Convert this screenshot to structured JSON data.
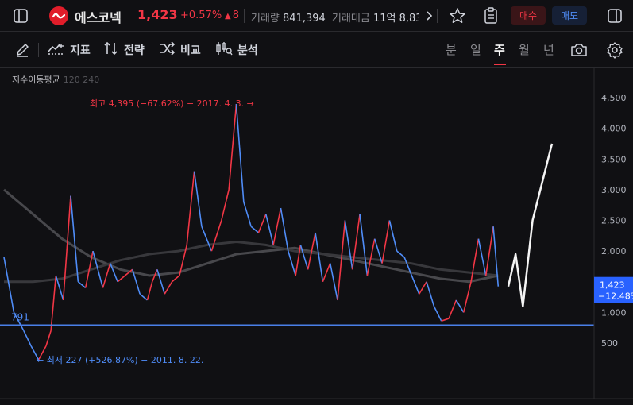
{
  "header": {
    "stock_name": "에스코넥",
    "price": "1,423",
    "change_pct": "+0.57%",
    "change_abs": "8",
    "change_arrow": "▲",
    "volume_label": "거래량",
    "volume_value": "841,394",
    "amount_label": "거래대금",
    "amount_value": "11억 8,83",
    "buy_label": "매수",
    "sell_label": "매도"
  },
  "toolbar": {
    "indicators_label": "지표",
    "strategy_label": "전략",
    "compare_label": "비교",
    "analysis_label": "분석",
    "periods": [
      "분",
      "일",
      "주",
      "월",
      "년"
    ],
    "active_period": "주"
  },
  "legend": {
    "title": "지수이동평균",
    "params": "120 240"
  },
  "colors": {
    "up": "#f23645",
    "down": "#4f8cf7",
    "hline": "#4a7fe8",
    "brand_logo": "#e11d2a",
    "ma_long": "#48484c",
    "ma_short": "#38383c",
    "projection": "#f5f5f5",
    "price_tag_bg": "#2962ff"
  },
  "chart_data": {
    "type": "line",
    "description_series": "weekly price series rendered as up/down colored segments",
    "yaxis": {
      "ticks": [
        "500",
        "1,000",
        "1,500",
        "2,000",
        "2,500",
        "3,000",
        "3,500",
        "4,000",
        "4,500"
      ],
      "ylim": [
        0,
        4900
      ]
    },
    "price_series": {
      "up_color": "#f23645",
      "down_color": "#4f8cf7",
      "x": [
        0,
        0.02,
        0.04,
        0.055,
        0.07,
        0.085,
        0.095,
        0.105,
        0.12,
        0.135,
        0.15,
        0.165,
        0.18,
        0.2,
        0.215,
        0.23,
        0.245,
        0.26,
        0.275,
        0.29,
        0.3,
        0.31,
        0.325,
        0.34,
        0.355,
        0.37,
        0.385,
        0.4,
        0.42,
        0.44,
        0.455,
        0.47,
        0.485,
        0.5,
        0.515,
        0.53,
        0.545,
        0.56,
        0.575,
        0.59,
        0.6,
        0.615,
        0.63,
        0.645,
        0.66,
        0.675,
        0.69,
        0.705,
        0.72,
        0.735,
        0.75,
        0.765,
        0.78,
        0.795,
        0.81,
        0.825,
        0.84,
        0.855,
        0.87,
        0.885,
        0.9,
        0.915,
        0.93,
        0.945,
        0.96,
        0.975,
        0.99,
        1.0
      ],
      "y": [
        1900,
        1000,
        700,
        450,
        227,
        450,
        700,
        1600,
        1200,
        2900,
        1500,
        1400,
        2000,
        1400,
        1800,
        1500,
        1600,
        1700,
        1300,
        1200,
        1500,
        1700,
        1300,
        1500,
        1600,
        2100,
        3300,
        2400,
        2000,
        2500,
        3000,
        4395,
        2800,
        2400,
        2300,
        2600,
        2100,
        2700,
        2000,
        1600,
        2100,
        1700,
        2300,
        1500,
        1800,
        1200,
        2500,
        1700,
        2600,
        1600,
        2200,
        1800,
        2500,
        2000,
        1900,
        1600,
        1300,
        1500,
        1100,
        860,
        900,
        1200,
        1000,
        1500,
        2200,
        1600,
        2400,
        1423
      ]
    },
    "ma_long": {
      "name": "120",
      "y": [
        3000,
        2600,
        2200,
        1900,
        1700,
        1600,
        1650,
        1800,
        1950,
        2000,
        2050,
        1950,
        1850,
        1750,
        1650,
        1550,
        1500,
        1600
      ]
    },
    "ma_short": {
      "name": "240",
      "y": [
        1500,
        1500,
        1550,
        1700,
        1850,
        1950,
        2000,
        2100,
        2150,
        2100,
        2000,
        1950,
        1900,
        1850,
        1800,
        1700,
        1650,
        1600
      ]
    },
    "horizontal_line": {
      "value": 791,
      "label": "791"
    },
    "projection": {
      "x": [
        0.82,
        0.85,
        0.88,
        0.92,
        1.0
      ],
      "y": [
        1423,
        1950,
        1100,
        2500,
        3750
      ]
    },
    "annotations": [
      {
        "text": "최고 4,395 (−67.62%) − 2017. 4. 3.",
        "value": 4395,
        "kind": "high"
      },
      {
        "text": "최저 227 (+526.87%) − 2011. 8. 22.",
        "value": 227,
        "kind": "low"
      }
    ],
    "last_price_tag": {
      "price": "1,423",
      "change": "−12.48%"
    }
  }
}
